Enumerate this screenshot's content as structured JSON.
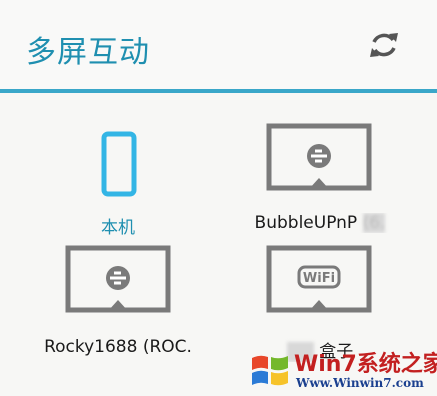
{
  "header": {
    "title": "多屏互动",
    "refresh_icon": "refresh-icon"
  },
  "colors": {
    "accent": "#1f8fb0",
    "rule": "#3aa7c9",
    "tv_frame": "#7a7a7a",
    "phone": "#33b5e5"
  },
  "devices": [
    {
      "label": "本机",
      "icon": "phone-icon"
    },
    {
      "label": "BubbleUPnP",
      "label_obscured": "(6.",
      "icon": "dlna-tv-icon"
    },
    {
      "label": "Rocky1688 (ROC.",
      "icon": "dlna-tv-icon"
    },
    {
      "label": "盒子",
      "icon": "wifi-tv-icon"
    }
  ],
  "watermark": {
    "text": "Win7系统之家",
    "url": "Www.Winwin7.com"
  }
}
